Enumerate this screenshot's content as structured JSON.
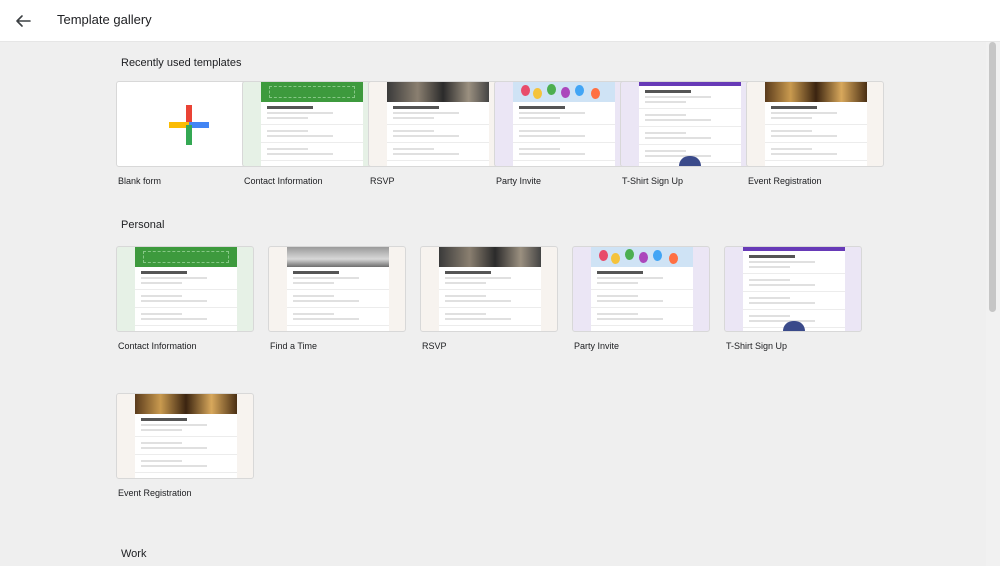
{
  "header": {
    "title": "Template gallery",
    "back_icon": "arrow-left-icon"
  },
  "sections": [
    {
      "title": "Recently used templates",
      "cards": [
        {
          "label": "Blank form",
          "kind": "blank"
        },
        {
          "label": "Contact Information",
          "kind": "green"
        },
        {
          "label": "RSVP",
          "kind": "rsvp"
        },
        {
          "label": "Party Invite",
          "kind": "party"
        },
        {
          "label": "T-Shirt Sign Up",
          "kind": "shirt"
        },
        {
          "label": "Event Registration",
          "kind": "event"
        }
      ]
    },
    {
      "title": "Personal",
      "cards": [
        {
          "label": "Contact Information",
          "kind": "green"
        },
        {
          "label": "Find a Time",
          "kind": "findtime"
        },
        {
          "label": "RSVP",
          "kind": "rsvp"
        },
        {
          "label": "Party Invite",
          "kind": "party"
        },
        {
          "label": "T-Shirt Sign Up",
          "kind": "shirt"
        },
        {
          "label": "Event Registration",
          "kind": "event"
        }
      ]
    },
    {
      "title": "Work",
      "cards": []
    }
  ],
  "colors": {
    "google_blue": "#4285F4",
    "google_red": "#EA4335",
    "google_yellow": "#FBBC04",
    "google_green": "#34A853",
    "contact_green": "#3d9a3d",
    "tshirt_purple": "#673ab7"
  }
}
